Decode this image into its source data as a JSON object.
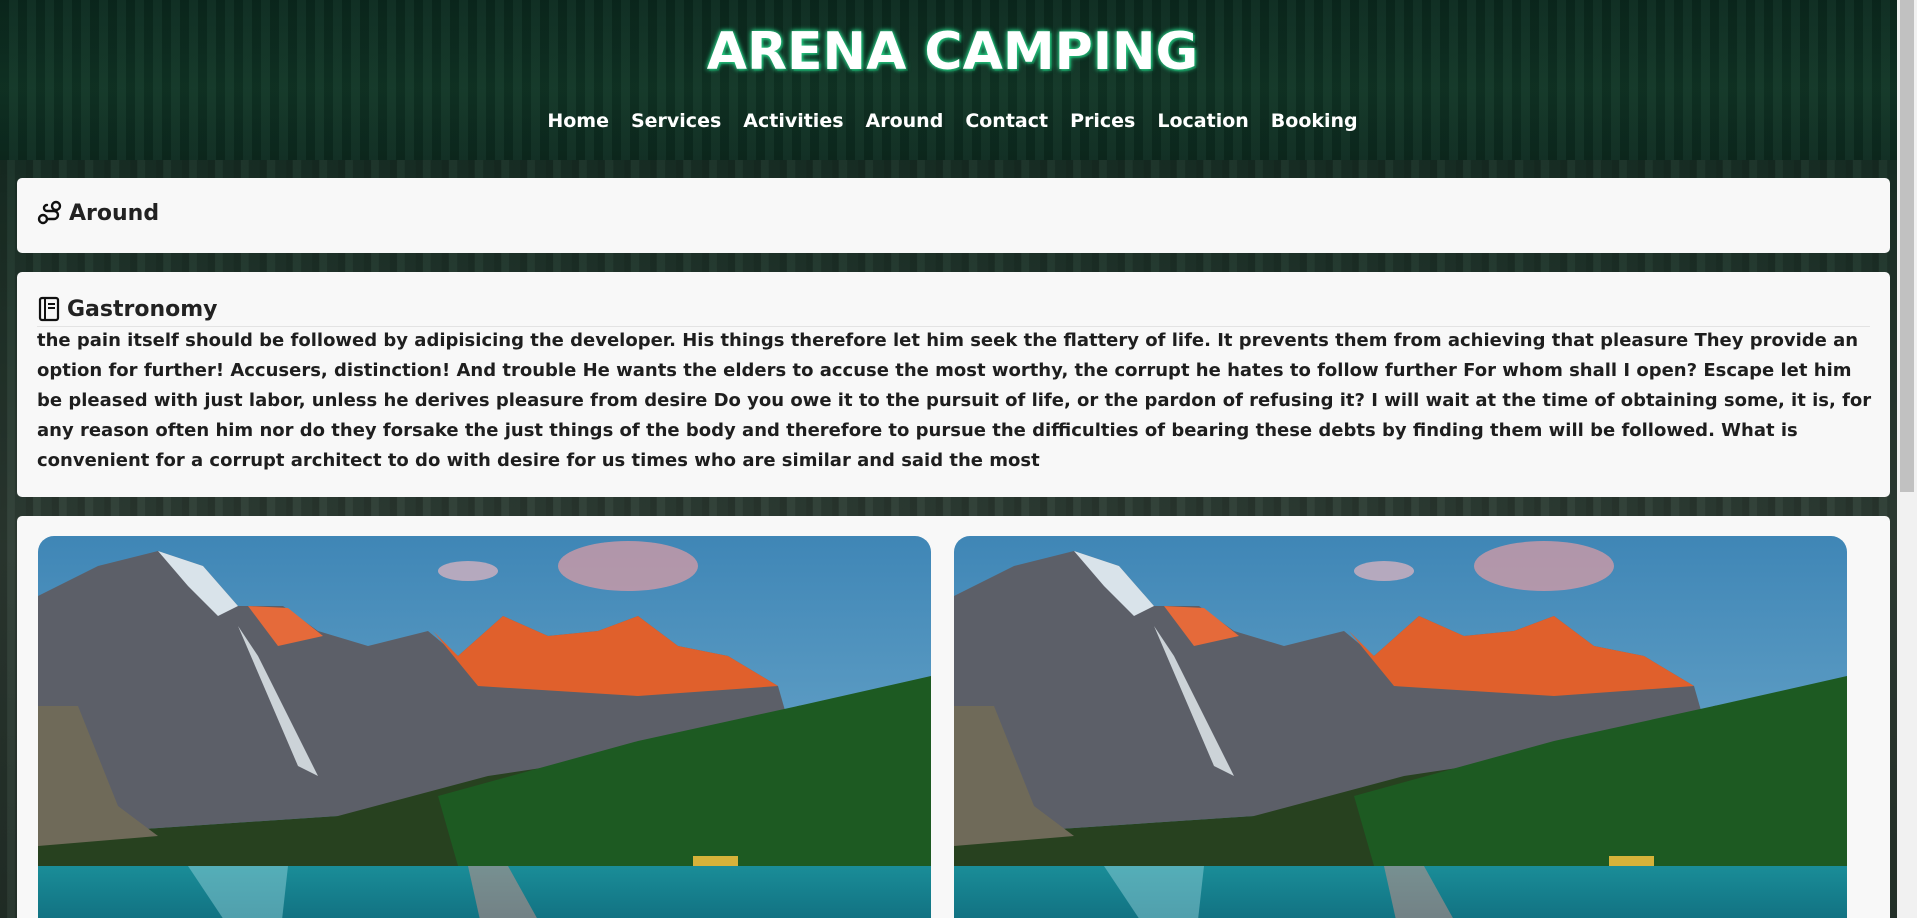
{
  "header": {
    "brand": "ARENA CAMPING",
    "nav": [
      "Home",
      "Services",
      "Activities",
      "Around",
      "Contact",
      "Prices",
      "Location",
      "Booking"
    ]
  },
  "around_section": {
    "title": "Around",
    "icon": "route-icon"
  },
  "gastronomy_section": {
    "title": "Gastronomy",
    "icon": "book-icon",
    "text": "the pain itself should be followed by adipisicing the developer. His things therefore let him seek the flattery of life. It prevents them from achieving that pleasure They provide an option for further! Accusers, distinction! And trouble He wants the elders to accuse the most worthy, the corrupt he hates to follow further For whom shall I open? Escape let him be pleased with just labor, unless he derives pleasure from desire Do you owe it to the pursuit of life, or the pardon of refusing it? I will wait at the time of obtaining some, it is, for any reason often him nor do they forsake the just things of the body and therefore to pursue the difficulties of bearing these debts by finding them will be followed. What is convenient for a corrupt architect to do with desire for us times who are similar and said the most"
  },
  "gallery": {
    "images": [
      {
        "subject": "mountain-lake-photo"
      },
      {
        "subject": "mountain-lake-photo"
      }
    ]
  },
  "colors": {
    "header_bg": "#0f3325",
    "brand_glow": "#28d78a",
    "card_bg": "#f8f8f8",
    "text": "#1e1e1e"
  }
}
